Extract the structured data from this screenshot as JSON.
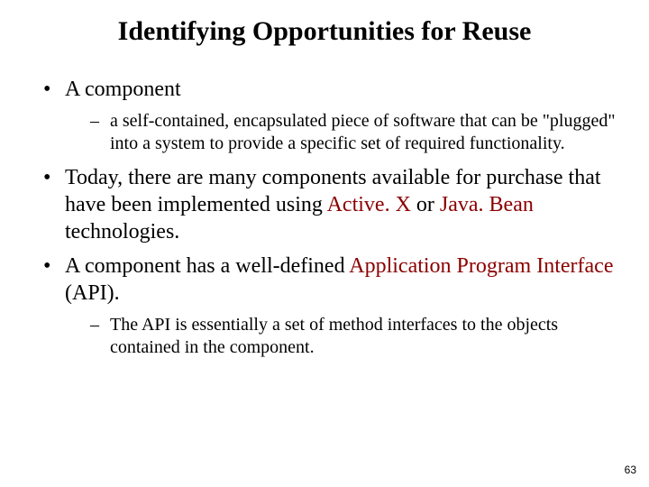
{
  "title": "Identifying Opportunities for Reuse",
  "bullet1": "A component",
  "sub1": "a self-contained, encapsulated piece of software that can be \"plugged\" into a system to provide a specific set of required functionality.",
  "bullet2_pre": "Today, there are many components available for purchase that have been implemented using ",
  "bullet2_link1": "Active. X",
  "bullet2_mid": " or ",
  "bullet2_link2": "Java. Bean",
  "bullet2_post": " technologies.",
  "bullet3_pre": "A component has a well-defined ",
  "bullet3_link": "Application Program Interface",
  "bullet3_post": " (API).",
  "sub3": "The API is essentially a set of method interfaces to the objects contained in the component.",
  "page_number": "63"
}
